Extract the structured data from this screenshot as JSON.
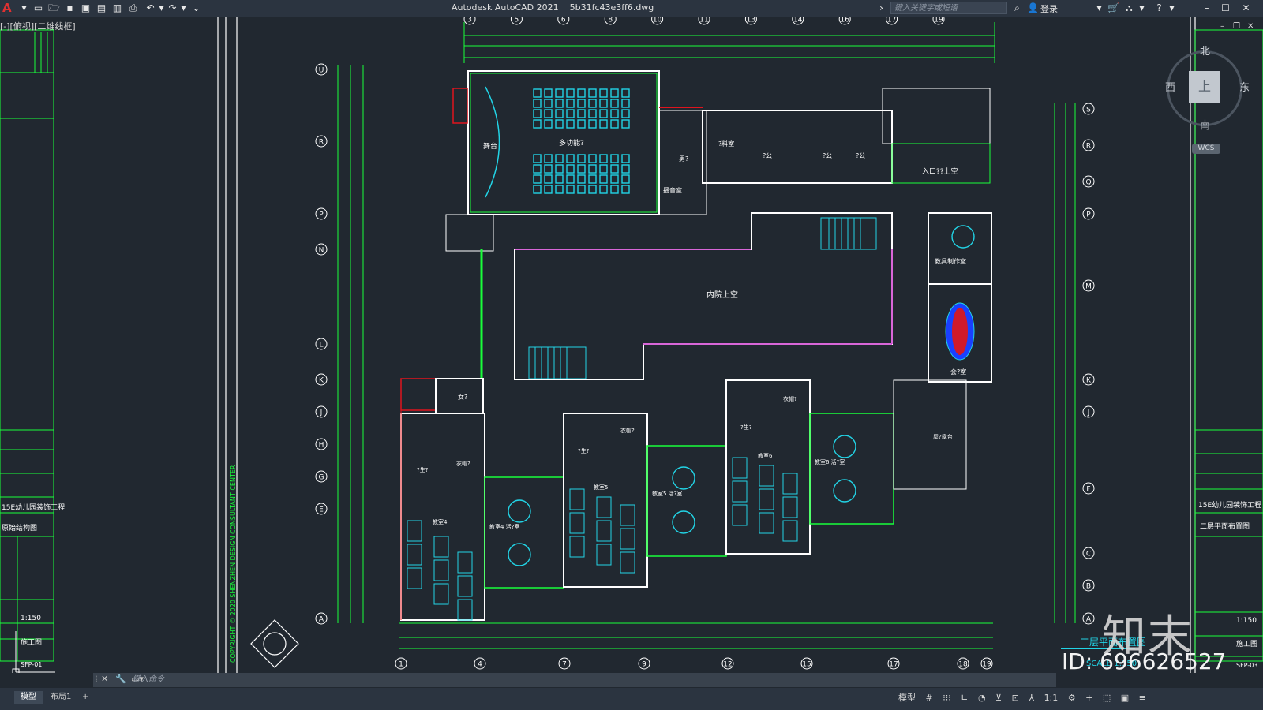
{
  "titlebar": {
    "app_name": "Autodesk AutoCAD 2021",
    "file_name": "5b31fc43e3ff6.dwg",
    "search_placeholder": "键入关键字或短语",
    "login_label": "登录"
  },
  "viewport": {
    "label": "[-][俯视][二维线框]"
  },
  "viewcube": {
    "north": "北",
    "south": "南",
    "east": "东",
    "west": "西",
    "face": "上",
    "wcs": "WCS"
  },
  "plan": {
    "room_labels": {
      "multi_hall": "多功能?",
      "stage": "舞台",
      "courtyard": "内院上空",
      "entrance": "入口??上空",
      "teaching_aid": "教具制作室",
      "meeting": "会?室",
      "lab": "?料室",
      "office1": "?公",
      "office2": "?公",
      "office3": "?公",
      "broadcast": "播音室",
      "male_wc": "男?",
      "female_wc": "女?",
      "class4": "教室4",
      "class4_play": "教室4\n活?室",
      "class5": "教室5",
      "class5_play": "教室5\n活?室",
      "class6": "教室6",
      "class6_play": "教室6\n活?室",
      "coat1": "衣帽?",
      "coat2": "衣帽?",
      "coat3": "衣帽?",
      "wc1": "?生?",
      "wc2": "?生?",
      "wc3": "?生?",
      "roof": "屋?露台"
    },
    "axis_top": [
      "3",
      "5",
      "6",
      "8",
      "10",
      "11",
      "13",
      "14",
      "16",
      "17",
      "19"
    ],
    "axis_bottom": [
      "1",
      "4",
      "7",
      "9",
      "12",
      "15",
      "17",
      "18",
      "19"
    ],
    "axis_left": [
      "U",
      "R",
      "P",
      "N",
      "L",
      "K",
      "J",
      "H",
      "G",
      "E",
      "A"
    ],
    "axis_right": [
      "S",
      "R",
      "Q",
      "P",
      "M",
      "K",
      "J",
      "F",
      "C",
      "B",
      "A"
    ],
    "drawing_title": "二层平面布置图",
    "scale": "SCALE  1:150"
  },
  "side_sheets": {
    "left_project": "15E幼儿园装饰工程",
    "left_drawing": "原始结构图",
    "left_scale": "1:150",
    "left_stage": "施工图",
    "left_sheet": "SFP-01",
    "right_project": "15E幼儿园装饰工程",
    "right_drawing": "二层平面布置图",
    "right_scale": "1:150",
    "right_stage": "施工图",
    "right_sheet": "SFP-03",
    "vertical_text": "COPYRIGHT © 2020 SHENZHEN DESIGN CONSULTANT CENTER"
  },
  "cmdline": {
    "placeholder": "键入命令"
  },
  "layout_tabs": [
    "模型",
    "布局1"
  ],
  "status": {
    "model": "模型",
    "scale": "1:1"
  },
  "watermarks": {
    "logo": "知末",
    "id": "ID: 696626527"
  }
}
